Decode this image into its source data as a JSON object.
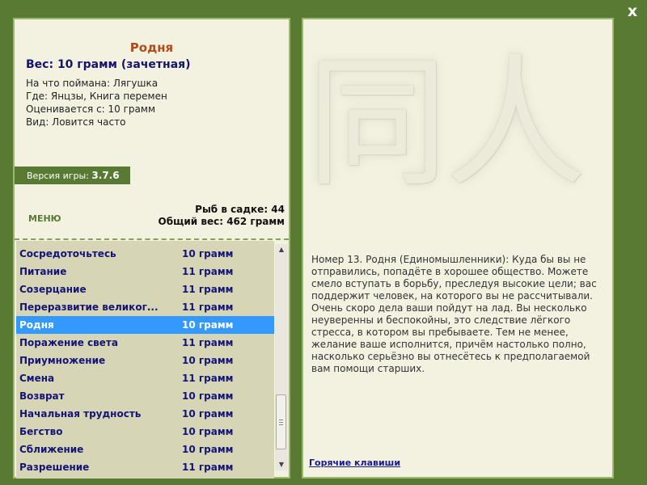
{
  "window": {
    "close_label": "x"
  },
  "fish": {
    "title": "Родня",
    "weight_line": "Вес: 10 грамм (зачетная)",
    "caught_on": "На что поймана: Лягушка",
    "location": "Где: Янцзы, Книга перемен",
    "valued_from": "Оценивается с: 10 грамм",
    "frequency": "Вид: Ловится часто"
  },
  "version": {
    "label": "Версия игры:",
    "number": "3.7.6"
  },
  "menu_label": "МЕНЮ",
  "stats": {
    "fish_count": "Рыб в садке: 44",
    "total_weight": "Общий вес: 462 грамм"
  },
  "fish_list": [
    {
      "name": "Сосредоточьтесь",
      "weight": "10 грамм"
    },
    {
      "name": "Питание",
      "weight": "11 грамм"
    },
    {
      "name": "Созерцание",
      "weight": "11 грамм"
    },
    {
      "name": "Переразвитие великог...",
      "weight": "11 грамм"
    },
    {
      "name": "Родня",
      "weight": "10 грамм"
    },
    {
      "name": "Поражение света",
      "weight": "11 грамм"
    },
    {
      "name": "Приумножение",
      "weight": "10 грамм"
    },
    {
      "name": "Смена",
      "weight": "11 грамм"
    },
    {
      "name": "Возврат",
      "weight": "10 грамм"
    },
    {
      "name": "Начальная трудность",
      "weight": "10 грамм"
    },
    {
      "name": "Бегство",
      "weight": "10 грамм"
    },
    {
      "name": "Сближение",
      "weight": "10 грамм"
    },
    {
      "name": "Разрешение",
      "weight": "11 грамм"
    }
  ],
  "selected_index": 4,
  "icons": {
    "scroll_up": "▲",
    "scroll_down": "▼"
  },
  "hexagram": {
    "glyph": "同人"
  },
  "description": "Номер 13. Родня (Единомышленники): Куда бы вы не отправились, попадёте в хорошее общество. Можете смело вступать в борьбу, преследуя высокие цели; вас поддержит человек, на которого вы не рассчитывали. Очень скоро дела ваши пойдут на лад. Вы несколько неуверенны и беспокойны, это следствие лёгкого стресса, в котором вы пребываете. Тем не менее, желание ваше исполнится, причём настолько полно, насколько серьёзно вы отнесётесь к предполагаемой вам помощи старших.",
  "hotkeys_label": "Горячие клавиши",
  "colors": {
    "background": "#587a32",
    "panel": "#f3f2e1",
    "list_bg": "#d6d6b6",
    "selected": "#3399ff",
    "title": "#b24a1a",
    "list_text": "#141478"
  }
}
